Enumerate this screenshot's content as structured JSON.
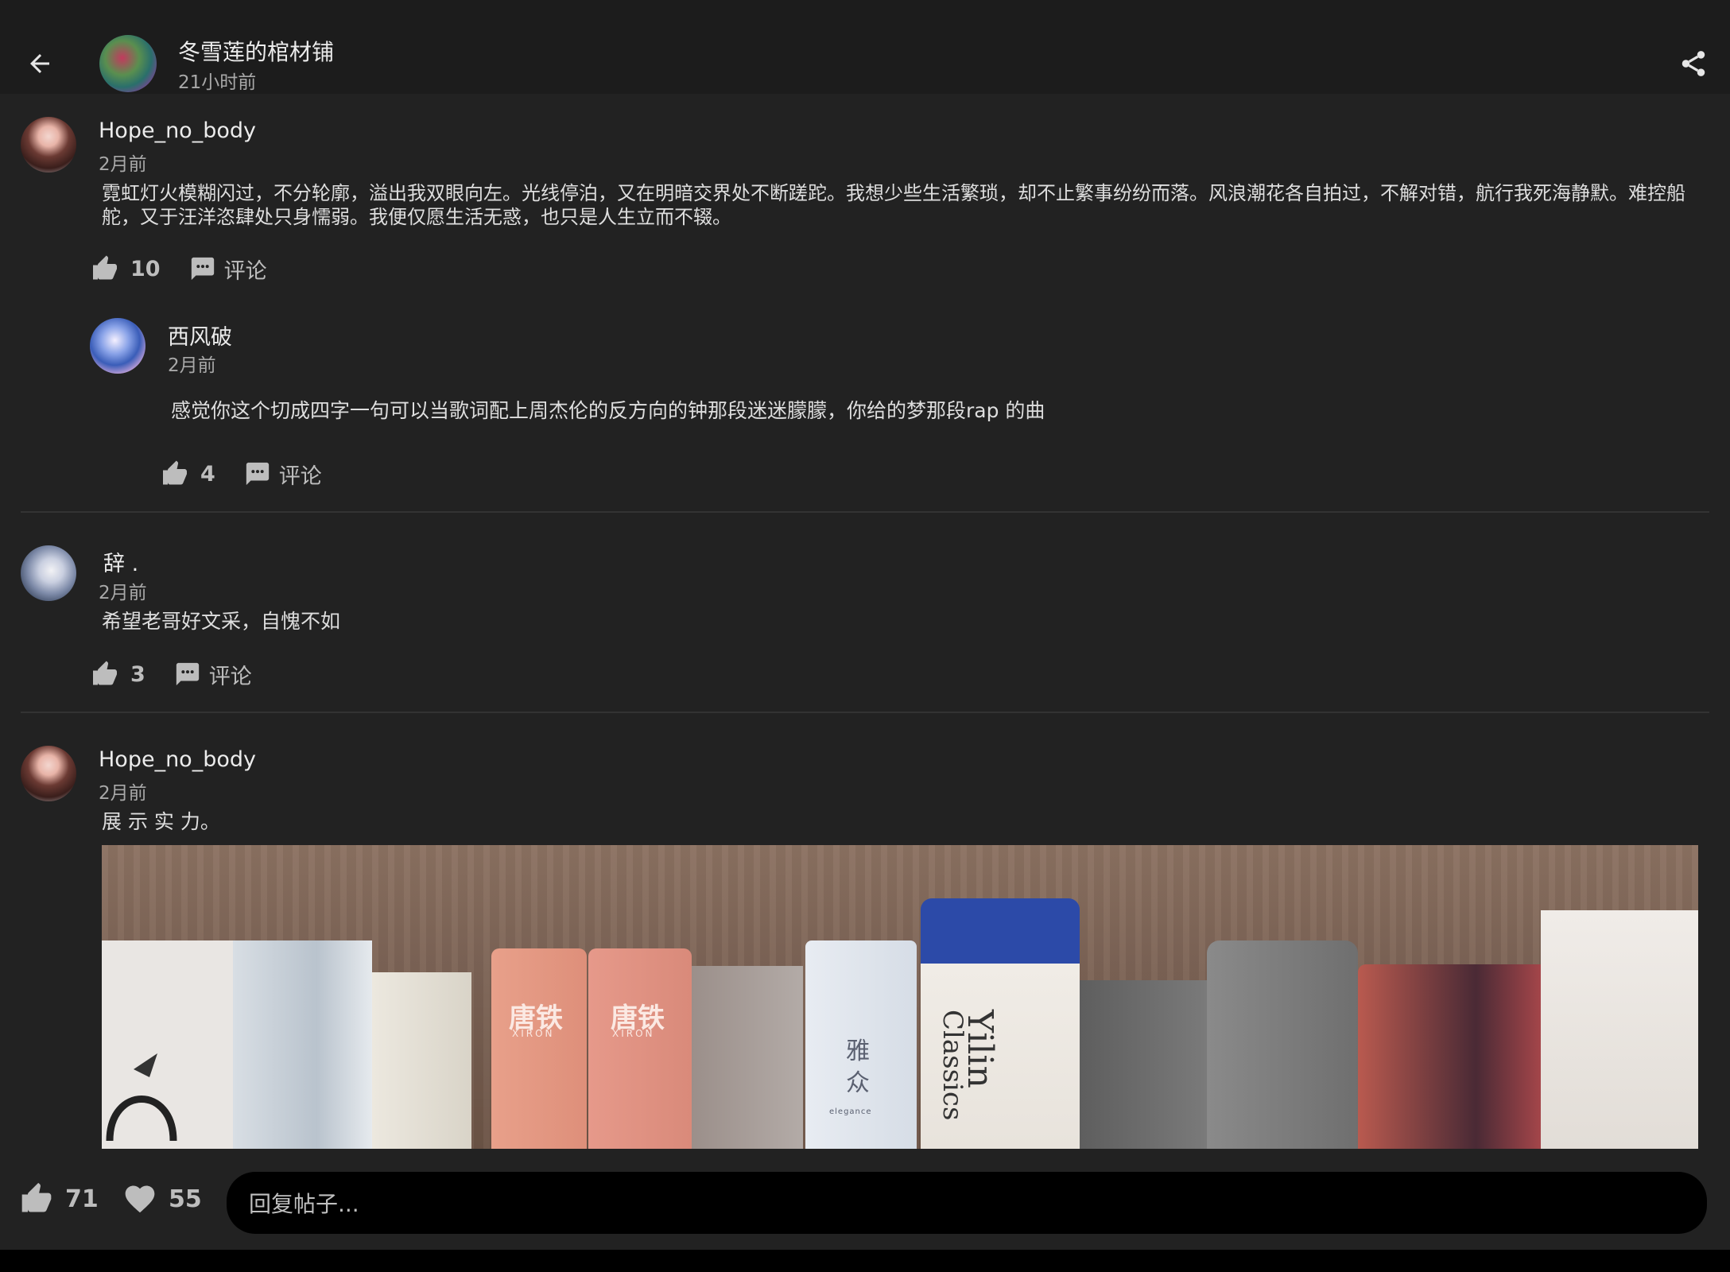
{
  "header": {
    "title": "冬雪莲的棺材铺",
    "subtitle": "21小时前"
  },
  "comments": [
    {
      "user": "Hope_no_body",
      "time": "2月前",
      "text": "霓虹灯火模糊闪过，不分轮廓，溢出我双眼向左。光线停泊，又在明暗交界处不断蹉跎。我想少些生活繁琐，却不止繁事纷纷而落。风浪潮花各自拍过，不解对错，航行我死海静默。难控船舵，又于汪洋恣肆处只身懦弱。我便仅愿生活无惑，也只是人生立而不辍。",
      "likes": "10",
      "comment_label": "评论",
      "reply": {
        "user": "西风破",
        "time": "2月前",
        "text": "感觉你这个切成四字一句可以当歌词配上周杰伦的反方向的钟那段迷迷朦朦，你给的梦那段rap 的曲",
        "likes": "4",
        "comment_label": "评论"
      }
    },
    {
      "user": "辞 .",
      "time": "2月前",
      "text": "希望老哥好文采，自愧不如",
      "likes": "3",
      "comment_label": "评论"
    },
    {
      "user": "Hope_no_body",
      "time": "2月前",
      "text": "展 示 实 力。"
    }
  ],
  "photo": {
    "book_brand": "唐铁",
    "book_brand_sub": "XIRON",
    "book_ya": "雅众",
    "book_ya_sub": "elegance",
    "book_yilin": "Yilin",
    "book_classics": "Classics"
  },
  "bottom": {
    "likes": "71",
    "favorites": "55",
    "reply_placeholder": "回复帖子..."
  }
}
